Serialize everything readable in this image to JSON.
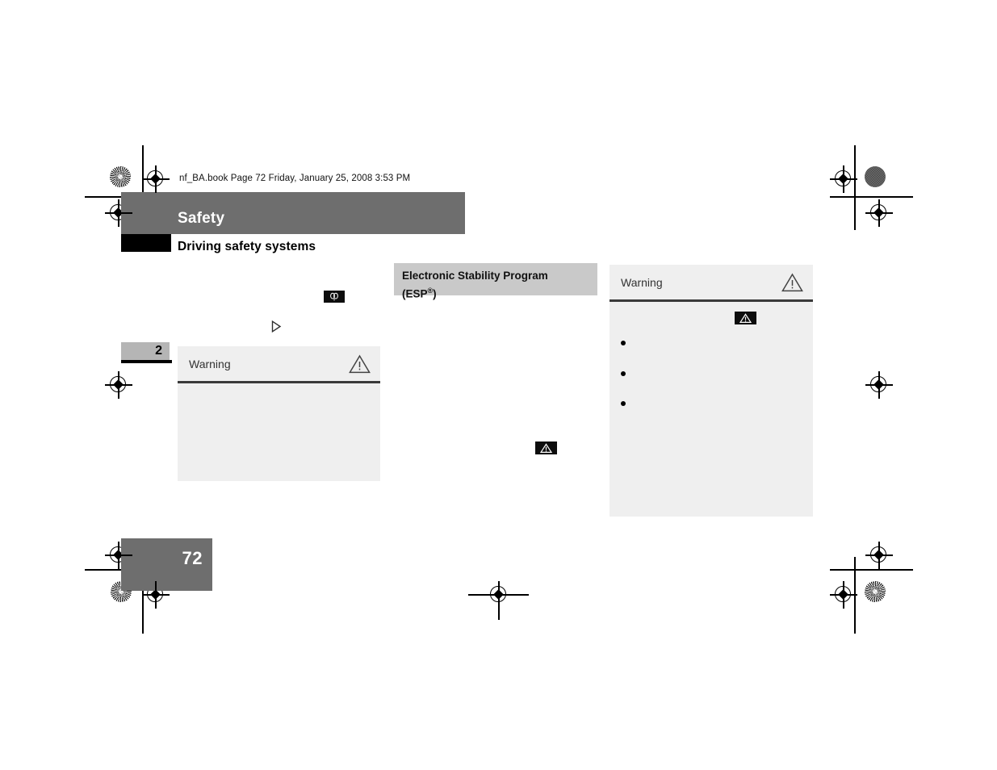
{
  "document": {
    "file_stamp": "nf_BA.book  Page 72  Friday, January 25, 2008  3:53 PM",
    "chapter_title": "Safety",
    "section_subtitle": "Driving safety systems",
    "chapter_tab_number": "2",
    "page_number": "72"
  },
  "colors": {
    "chapter_band": "#6e6e6e",
    "black_block": "#000000",
    "chapter_tab": "#b5b5b5",
    "section_head": "#c9c9c9",
    "warn_box_bg": "#efefef",
    "warn_rule": "#3a3a3a",
    "badge_bg": "#0d0d0d",
    "page_bg": "#ffffff"
  },
  "center_column": {
    "section_heading": {
      "line1": "Electronic Stability Program",
      "line2_prefix": "(ESP",
      "line2_sup": "®",
      "line2_suffix": ")"
    },
    "inline_badge": "warning-triangle-badge-icon"
  },
  "left_column": {
    "symbol_badge": "indicator-lamp-badge-icon",
    "arrow_marker": "triangle-right-marker-icon",
    "warning_box": {
      "title": "Warning",
      "icon": "warning-triangle-icon"
    }
  },
  "right_column": {
    "warning_box": {
      "title": "Warning",
      "icon": "warning-triangle-icon",
      "inline_badge": "warning-triangle-badge-icon",
      "bullets": [
        "",
        "",
        ""
      ]
    }
  },
  "registration": {
    "crosshair": "registration-crosshair-mark",
    "halftone_star": "registration-halftone-star-mark",
    "halftone_solid": "registration-halftone-solid-mark",
    "crop_line": "crop-mark-line"
  }
}
